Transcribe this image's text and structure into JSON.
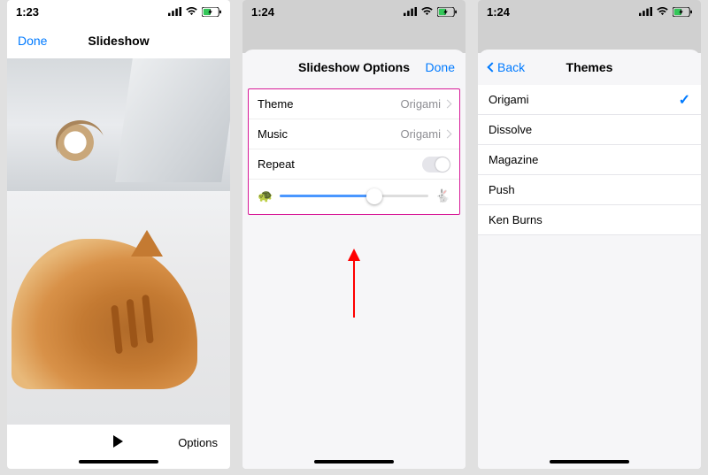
{
  "phone1": {
    "time": "1:23",
    "nav_done": "Done",
    "nav_title": "Slideshow",
    "bottom_options": "Options"
  },
  "phone2": {
    "time": "1:24",
    "nav_title": "Slideshow Options",
    "nav_done": "Done",
    "rows": {
      "theme_label": "Theme",
      "theme_value": "Origami",
      "music_label": "Music",
      "music_value": "Origami",
      "repeat_label": "Repeat"
    },
    "repeat_on": false,
    "speed_percent": 64
  },
  "phone3": {
    "time": "1:24",
    "nav_back": "Back",
    "nav_title": "Themes",
    "items": [
      "Origami",
      "Dissolve",
      "Magazine",
      "Push",
      "Ken Burns"
    ],
    "selected_index": 0
  },
  "annotation": {
    "highlight_color": "#d81b98",
    "arrow_color": "#ff0000"
  }
}
